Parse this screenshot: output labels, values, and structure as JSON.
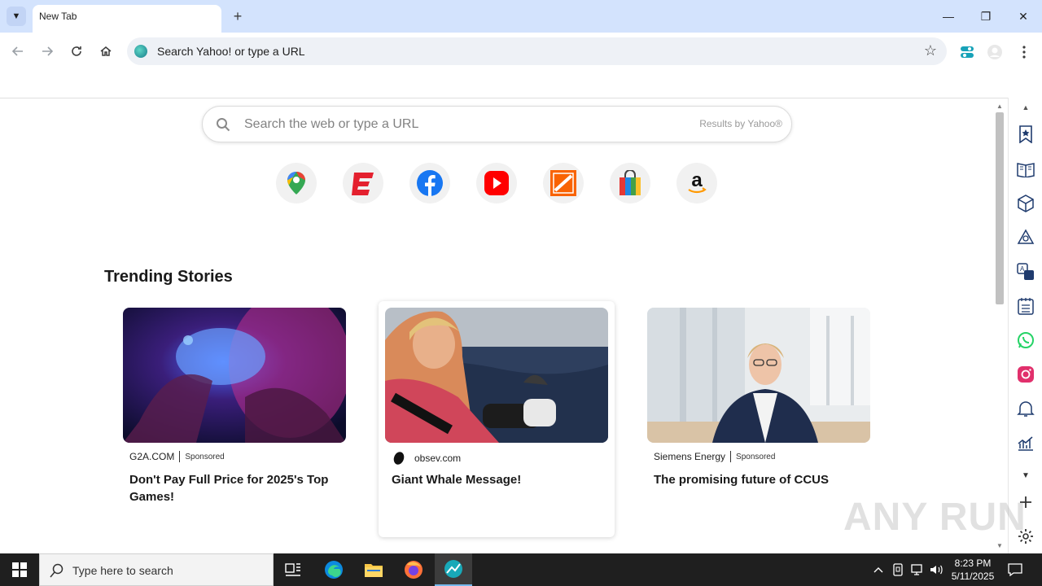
{
  "browser": {
    "tab_title": "New Tab",
    "omnibox_text": "Search Yahoo! or type a URL"
  },
  "page": {
    "search_placeholder": "Search the web or type a URL",
    "results_by": "Results by Yahoo®",
    "shortcuts": [
      "google-maps",
      "espn",
      "facebook",
      "youtube",
      "home-depot",
      "shopping",
      "amazon"
    ],
    "trending_title": "Trending Stories",
    "cards": [
      {
        "source": "G2A.COM",
        "sponsored": "Sponsored",
        "headline": "Don't Pay Full Price for 2025's Top Games!"
      },
      {
        "source": "obsev.com",
        "sponsored": "",
        "headline": "Giant Whale Message!"
      },
      {
        "source": "Siemens Energy",
        "sponsored": "Sponsored",
        "headline": "The promising future of CCUS"
      }
    ]
  },
  "watermark": "ANY RUN",
  "taskbar": {
    "search_placeholder": "Type here to search",
    "time": "8:23 PM",
    "date": "5/11/2025"
  },
  "colors": {
    "titlebar": "#d3e3fd",
    "omnibox": "#eef1f6",
    "taskbar": "#1f1f1f"
  }
}
